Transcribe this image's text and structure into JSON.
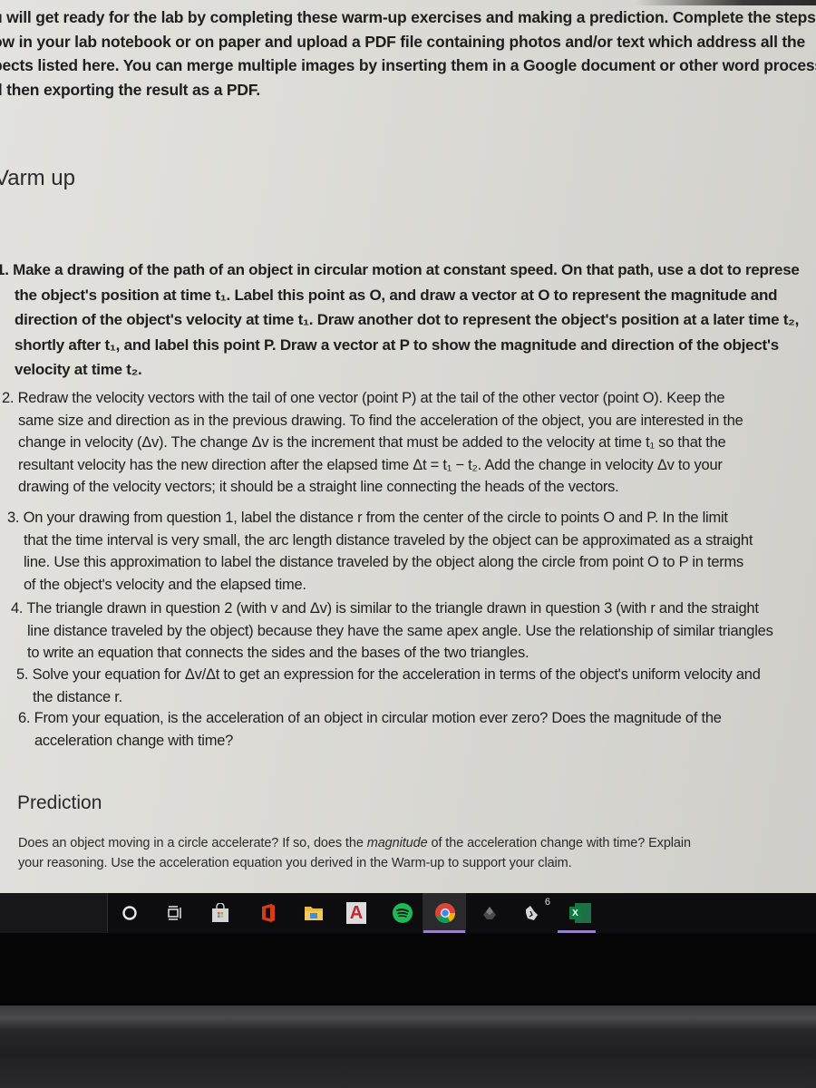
{
  "document": {
    "intro_lines": [
      "u will get ready for the lab by completing these warm-up exercises and making a prediction. Complete the steps",
      "ow in your lab notebook or on paper and upload a PDF file containing photos and/or text which address all the",
      "pects listed here. You can merge multiple images by inserting them in a Google document or other word processo",
      "d then exporting the result as a PDF."
    ],
    "warmup_title": "Varm up",
    "questions": [
      {
        "number": "1.",
        "lines": [
          "Make a drawing of the path of an object in circular motion at constant speed.  On that path, use a dot to represe",
          "the object's position at time t₁.  Label this point as O, and draw a vector at O to represent the magnitude and",
          "direction of the object's velocity at time t₁.  Draw another dot to represent the object's position at a later time t₂,",
          "shortly after t₁, and label this point P.  Draw a vector at P to show the magnitude and direction of the object's",
          "velocity at time t₂."
        ]
      },
      {
        "number": "2.",
        "lines": [
          "Redraw the velocity vectors with the tail of one vector (point P) at the tail of the other vector (point O).  Keep the",
          "same size and direction as in the previous drawing.  To find the acceleration of the object, you are interested in the",
          "change in velocity (Δv).   The change Δv is the increment that must be added to the velocity at time t₁ so that the",
          "resultant velocity has the new direction after the elapsed time Δt = t₁ − t₂.  Add the change in velocity Δv to your",
          "drawing of the velocity vectors; it should be a straight line connecting the heads of the vectors."
        ]
      },
      {
        "number": "3.",
        "lines": [
          "On your drawing from question 1, label the distance r from the center of the circle to points O and P.  In the limit",
          "that the time interval is very small, the arc length distance traveled by the object can be approximated as a straight",
          "line.  Use this approximation to label the distance traveled by the object along the circle from point O to P in terms",
          "of the object's velocity and the elapsed time."
        ]
      },
      {
        "number": "4.",
        "lines": [
          "The triangle drawn in question 2 (with v and Δv) is similar to the triangle drawn in question 3 (with r and the straight",
          "line distance traveled by the object) because they have the same apex angle.  Use the relationship of similar triangles",
          "to write an equation that connects the sides and the bases of the two triangles."
        ]
      },
      {
        "number": "5.",
        "lines": [
          "Solve your equation for Δv/Δt to get an expression for the acceleration in terms of the object's uniform velocity and",
          "the distance r."
        ]
      },
      {
        "number": "6.",
        "lines": [
          "From your equation, is the acceleration of an object in circular motion ever zero?  Does the magnitude of the",
          "acceleration change with time?"
        ]
      }
    ],
    "prediction_title": "Prediction",
    "prediction": {
      "line1_before": "Does an object moving in a circle accelerate?  If so, does the ",
      "line1_emph": "magnitude",
      "line1_after": " of the acceleration change with time? Explain",
      "line2": "your reasoning.  Use the acceleration equation you derived in the Warm-up to support your claim."
    }
  },
  "taskbar": {
    "items": [
      {
        "icon": "cortana-circle-icon",
        "active": false
      },
      {
        "icon": "task-view-icon",
        "active": false
      },
      {
        "icon": "microsoft-store-icon",
        "active": false
      },
      {
        "icon": "office-icon",
        "active": false
      },
      {
        "icon": "file-explorer-icon",
        "active": false
      },
      {
        "icon": "access-app-icon",
        "active": false,
        "label": "A"
      },
      {
        "icon": "spotify-icon",
        "active": false
      },
      {
        "icon": "chrome-icon",
        "active": true
      },
      {
        "icon": "steam-like-app-icon",
        "active": false
      },
      {
        "icon": "notification-app-icon",
        "active": false,
        "badge": "6"
      },
      {
        "icon": "excel-icon",
        "active": true,
        "label": "X"
      }
    ],
    "accent_color": "#9b7fc9"
  }
}
